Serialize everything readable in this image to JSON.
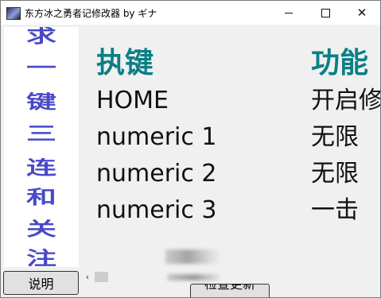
{
  "window": {
    "title": "东方冰之勇者记修改器 by ギナ",
    "controls": {
      "minimize": "—",
      "maximize": "☐",
      "close": "✕"
    }
  },
  "banner": {
    "chars": [
      "求",
      "一",
      "键",
      "三",
      "连",
      "和",
      "关",
      "注"
    ],
    "color": "#4848c8"
  },
  "hotkeys": {
    "header_key": "执键",
    "header_function": "功能",
    "header_color": "#0b7f86",
    "rows": [
      {
        "key": "HOME",
        "function": "开启修改"
      },
      {
        "key": "numeric 1",
        "function": "无限"
      },
      {
        "key": "numeric 2",
        "function": "无限"
      },
      {
        "key": "numeric 3",
        "function": "一击"
      }
    ]
  },
  "buttons": {
    "help": "说明",
    "update": "检查更新"
  },
  "scrollbar": {
    "left_arrow": "‹"
  }
}
